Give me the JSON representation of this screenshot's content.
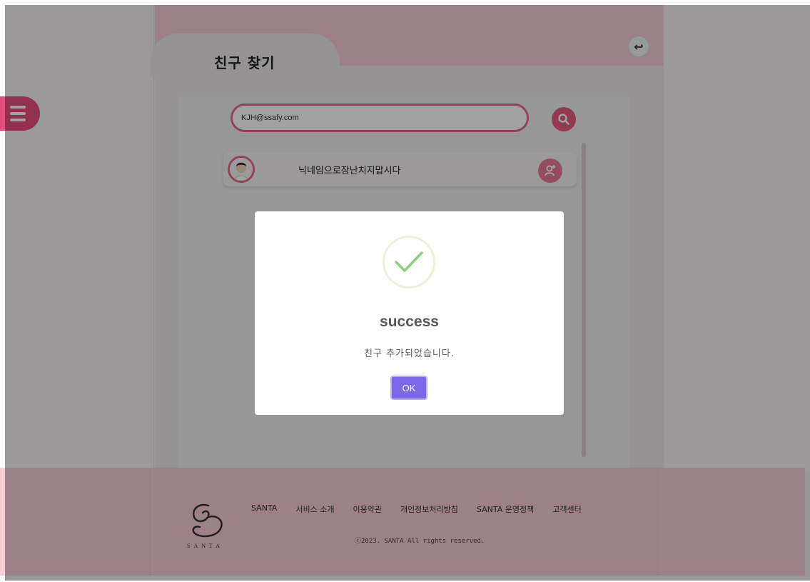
{
  "page": {
    "title": "친구 찾기",
    "back_symbol": "↩"
  },
  "search": {
    "value": "KJH@ssafy.com"
  },
  "friends": [
    {
      "nickname": "닉네임으로장난치지맙시다"
    }
  ],
  "footer": {
    "brand": "SANTA",
    "links": [
      "SANTA",
      "서비스 소개",
      "이용약관",
      "개인정보처리방침",
      "SANTA 운영정책",
      "고객센터"
    ],
    "copyright": "ⓒ2023. SANTA All rights reserved."
  },
  "dialog": {
    "title": "success",
    "message": "친구 추가되었습니다.",
    "ok_label": "OK"
  },
  "colors": {
    "accent": "#e64c7d",
    "footer_bg": "#f7cfd7",
    "ok_button": "#7d68e8",
    "check": "#8fcf7b"
  },
  "icons": [
    "menu-icon",
    "search-icon",
    "back-icon",
    "add-friend-icon",
    "success-check-icon",
    "santa-logo-icon"
  ]
}
